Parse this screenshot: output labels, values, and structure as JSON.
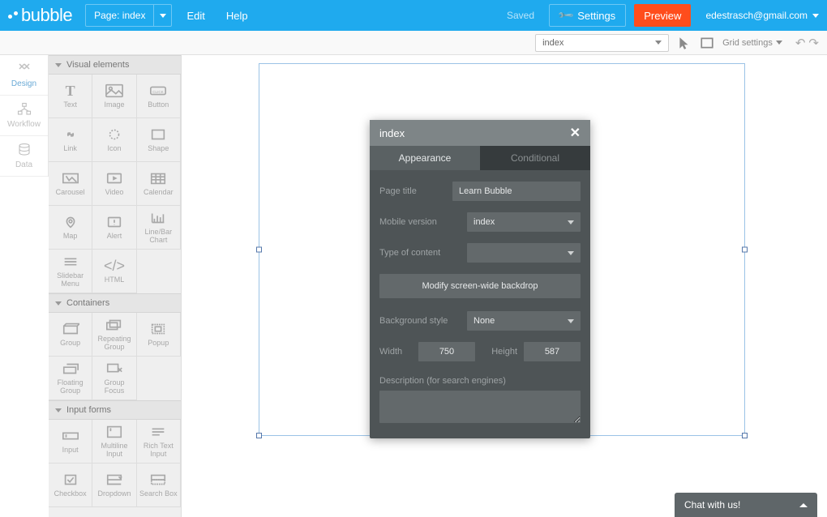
{
  "logo_text": "bubble",
  "topbar": {
    "page_select_label": "Page: index",
    "edit": "Edit",
    "help": "Help",
    "saved": "Saved",
    "settings": "Settings",
    "preview": "Preview",
    "user_email": "edestrasch@gmail.com"
  },
  "sectoolbar": {
    "view_dropdown_value": "index",
    "grid_settings": "Grid settings"
  },
  "lefttabs": {
    "design": "Design",
    "workflow": "Workflow",
    "data": "Data"
  },
  "palette": {
    "visual_elements": "Visual elements",
    "containers": "Containers",
    "input_forms": "Input forms",
    "items_visual": [
      "Text",
      "Image",
      "Button",
      "Link",
      "Icon",
      "Shape",
      "Carousel",
      "Video",
      "Calendar",
      "Map",
      "Alert",
      "Line/Bar Chart",
      "Slidebar Menu",
      "HTML"
    ],
    "items_containers": [
      "Group",
      "Repeating Group",
      "Popup",
      "Floating Group",
      "Group Focus"
    ],
    "items_inputs": [
      "Input",
      "Multiline Input",
      "Rich Text Input",
      "Checkbox",
      "Dropdown",
      "Search Box"
    ]
  },
  "prop": {
    "title": "index",
    "tab_appearance": "Appearance",
    "tab_conditional": "Conditional",
    "page_title_label": "Page title",
    "page_title_value": "Learn Bubble",
    "mobile_label": "Mobile version",
    "mobile_value": "index",
    "type_label": "Type of content",
    "type_value": "",
    "backdrop_btn": "Modify screen-wide backdrop",
    "bgstyle_label": "Background style",
    "bgstyle_value": "None",
    "width_label": "Width",
    "width_value": "750",
    "height_label": "Height",
    "height_value": "587",
    "desc_label": "Description (for search engines)"
  },
  "chat": {
    "label": "Chat with us!"
  }
}
